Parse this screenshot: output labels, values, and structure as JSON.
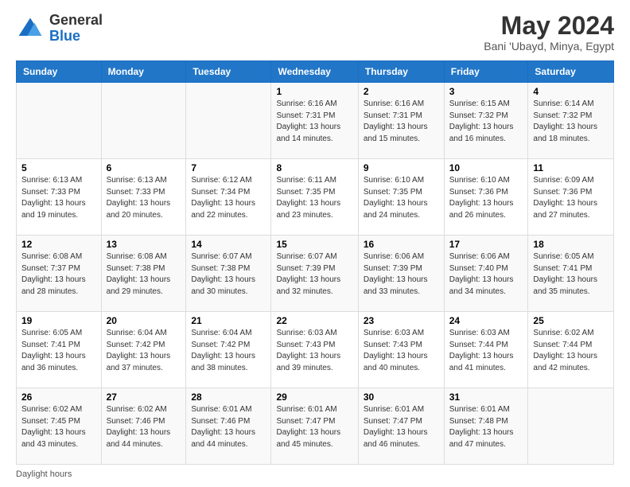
{
  "header": {
    "logo_general": "General",
    "logo_blue": "Blue",
    "month_title": "May 2024",
    "location": "Bani 'Ubayd, Minya, Egypt"
  },
  "days_of_week": [
    "Sunday",
    "Monday",
    "Tuesday",
    "Wednesday",
    "Thursday",
    "Friday",
    "Saturday"
  ],
  "weeks": [
    [
      {
        "day": "",
        "info": ""
      },
      {
        "day": "",
        "info": ""
      },
      {
        "day": "",
        "info": ""
      },
      {
        "day": "1",
        "info": "Sunrise: 6:16 AM\nSunset: 7:31 PM\nDaylight: 13 hours and 14 minutes."
      },
      {
        "day": "2",
        "info": "Sunrise: 6:16 AM\nSunset: 7:31 PM\nDaylight: 13 hours and 15 minutes."
      },
      {
        "day": "3",
        "info": "Sunrise: 6:15 AM\nSunset: 7:32 PM\nDaylight: 13 hours and 16 minutes."
      },
      {
        "day": "4",
        "info": "Sunrise: 6:14 AM\nSunset: 7:32 PM\nDaylight: 13 hours and 18 minutes."
      }
    ],
    [
      {
        "day": "5",
        "info": "Sunrise: 6:13 AM\nSunset: 7:33 PM\nDaylight: 13 hours and 19 minutes."
      },
      {
        "day": "6",
        "info": "Sunrise: 6:13 AM\nSunset: 7:33 PM\nDaylight: 13 hours and 20 minutes."
      },
      {
        "day": "7",
        "info": "Sunrise: 6:12 AM\nSunset: 7:34 PM\nDaylight: 13 hours and 22 minutes."
      },
      {
        "day": "8",
        "info": "Sunrise: 6:11 AM\nSunset: 7:35 PM\nDaylight: 13 hours and 23 minutes."
      },
      {
        "day": "9",
        "info": "Sunrise: 6:10 AM\nSunset: 7:35 PM\nDaylight: 13 hours and 24 minutes."
      },
      {
        "day": "10",
        "info": "Sunrise: 6:10 AM\nSunset: 7:36 PM\nDaylight: 13 hours and 26 minutes."
      },
      {
        "day": "11",
        "info": "Sunrise: 6:09 AM\nSunset: 7:36 PM\nDaylight: 13 hours and 27 minutes."
      }
    ],
    [
      {
        "day": "12",
        "info": "Sunrise: 6:08 AM\nSunset: 7:37 PM\nDaylight: 13 hours and 28 minutes."
      },
      {
        "day": "13",
        "info": "Sunrise: 6:08 AM\nSunset: 7:38 PM\nDaylight: 13 hours and 29 minutes."
      },
      {
        "day": "14",
        "info": "Sunrise: 6:07 AM\nSunset: 7:38 PM\nDaylight: 13 hours and 30 minutes."
      },
      {
        "day": "15",
        "info": "Sunrise: 6:07 AM\nSunset: 7:39 PM\nDaylight: 13 hours and 32 minutes."
      },
      {
        "day": "16",
        "info": "Sunrise: 6:06 AM\nSunset: 7:39 PM\nDaylight: 13 hours and 33 minutes."
      },
      {
        "day": "17",
        "info": "Sunrise: 6:06 AM\nSunset: 7:40 PM\nDaylight: 13 hours and 34 minutes."
      },
      {
        "day": "18",
        "info": "Sunrise: 6:05 AM\nSunset: 7:41 PM\nDaylight: 13 hours and 35 minutes."
      }
    ],
    [
      {
        "day": "19",
        "info": "Sunrise: 6:05 AM\nSunset: 7:41 PM\nDaylight: 13 hours and 36 minutes."
      },
      {
        "day": "20",
        "info": "Sunrise: 6:04 AM\nSunset: 7:42 PM\nDaylight: 13 hours and 37 minutes."
      },
      {
        "day": "21",
        "info": "Sunrise: 6:04 AM\nSunset: 7:42 PM\nDaylight: 13 hours and 38 minutes."
      },
      {
        "day": "22",
        "info": "Sunrise: 6:03 AM\nSunset: 7:43 PM\nDaylight: 13 hours and 39 minutes."
      },
      {
        "day": "23",
        "info": "Sunrise: 6:03 AM\nSunset: 7:43 PM\nDaylight: 13 hours and 40 minutes."
      },
      {
        "day": "24",
        "info": "Sunrise: 6:03 AM\nSunset: 7:44 PM\nDaylight: 13 hours and 41 minutes."
      },
      {
        "day": "25",
        "info": "Sunrise: 6:02 AM\nSunset: 7:44 PM\nDaylight: 13 hours and 42 minutes."
      }
    ],
    [
      {
        "day": "26",
        "info": "Sunrise: 6:02 AM\nSunset: 7:45 PM\nDaylight: 13 hours and 43 minutes."
      },
      {
        "day": "27",
        "info": "Sunrise: 6:02 AM\nSunset: 7:46 PM\nDaylight: 13 hours and 44 minutes."
      },
      {
        "day": "28",
        "info": "Sunrise: 6:01 AM\nSunset: 7:46 PM\nDaylight: 13 hours and 44 minutes."
      },
      {
        "day": "29",
        "info": "Sunrise: 6:01 AM\nSunset: 7:47 PM\nDaylight: 13 hours and 45 minutes."
      },
      {
        "day": "30",
        "info": "Sunrise: 6:01 AM\nSunset: 7:47 PM\nDaylight: 13 hours and 46 minutes."
      },
      {
        "day": "31",
        "info": "Sunrise: 6:01 AM\nSunset: 7:48 PM\nDaylight: 13 hours and 47 minutes."
      },
      {
        "day": "",
        "info": ""
      }
    ]
  ],
  "footer": {
    "daylight_label": "Daylight hours"
  }
}
